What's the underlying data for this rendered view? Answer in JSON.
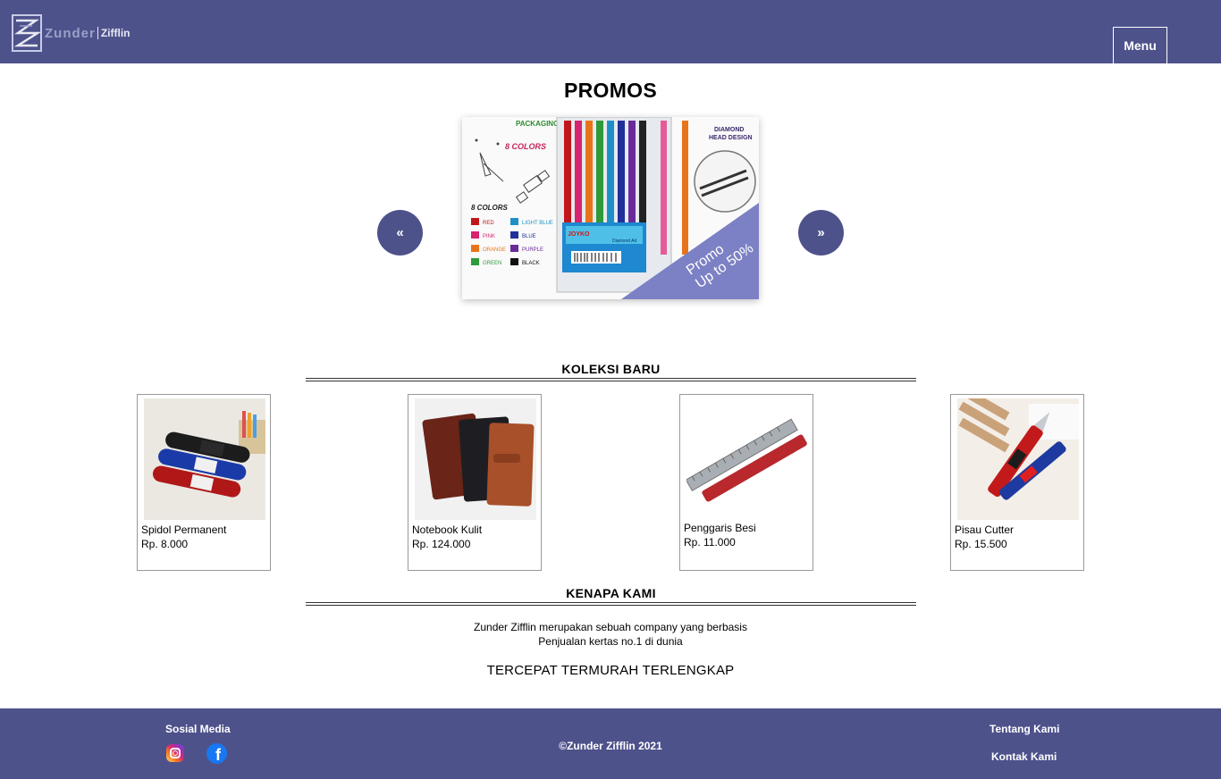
{
  "header": {
    "logo_primary": "Zunder",
    "logo_secondary": "Zifflin",
    "menu_label": "Menu"
  },
  "promos": {
    "title": "PROMOS",
    "prev_label": "«",
    "next_label": "»",
    "slide": {
      "packaging_label": "PACKAGING",
      "colors_label": "8 COLORS",
      "diamond_label_1": "DIAMOND",
      "diamond_label_2": "HEAD DESIGN",
      "legend_title": "8 COLORS",
      "legend": [
        "RED",
        "LIGHT BLUE",
        "PINK",
        "BLUE",
        "ORANGE",
        "PURPLE",
        "GREEN",
        "BLACK"
      ],
      "brand": "JOYKO",
      "brand_sub": "Diamond Art",
      "badge_line1": "Promo",
      "badge_line2": "Up to 50%"
    }
  },
  "new_collection": {
    "title": "KOLEKSI BARU",
    "products": [
      {
        "name": "Spidol Permanent",
        "price": "Rp. 8.000"
      },
      {
        "name": "Notebook Kulit",
        "price": "Rp. 124.000"
      },
      {
        "name": "Penggaris Besi",
        "price": "Rp. 11.000"
      },
      {
        "name": "Pisau Cutter",
        "price": "Rp. 15.500"
      }
    ]
  },
  "why_us": {
    "title": "KENAPA KAMI",
    "line1": "Zunder Zifflin merupakan sebuah company yang berbasis",
    "line2": "Penjualan kertas no.1 di dunia",
    "tagline": "TERCEPAT TERMURAH TERLENGKAP"
  },
  "footer": {
    "social_title": "Sosial Media",
    "social_icons": [
      "instagram-icon",
      "facebook-icon"
    ],
    "facebook_glyph": "f",
    "copyright": "©Zunder Zifflin 2021",
    "links": [
      "Tentang Kami",
      "Kontak Kami"
    ]
  },
  "colors": {
    "brand": "#4e528b",
    "badge": "#7c80c4"
  }
}
